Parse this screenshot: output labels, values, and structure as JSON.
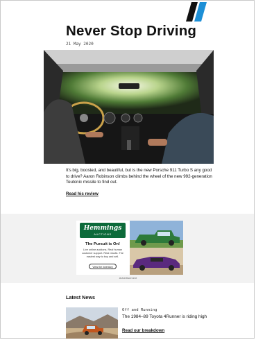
{
  "header": {
    "logo_icon": "double-slash-stripe-logo",
    "title": "Never Stop Driving",
    "date": "21 May 2020"
  },
  "feature": {
    "image_alt_icon": "car-interior-photo",
    "lede": "It's big, boosted, and beautiful, but is the new Porsche 911 Turbo S any good to drive? Aaron Robinson climbs behind the wheel of the new 992-generation Teutonic missile to find out.",
    "link_label": "Read his review"
  },
  "advertisement": {
    "brand": "Hemmings",
    "brand_sub": "AUCTIONS",
    "headline": "The Pursuit is On!",
    "body": "Live online auctions. Real human customer support. Real results. The easiest way to buy and sell.",
    "button_label": "View the inventory",
    "label": "Advertisement"
  },
  "latest_news": {
    "heading": "Latest News",
    "items": [
      {
        "kicker": "Off and Running",
        "headline": "The 1984–89 Toyota 4Runner is riding high",
        "link_label": "Read our breakdown"
      }
    ]
  },
  "colors": {
    "logo_blue": "#1d8fd6",
    "hemmings_green": "#0c6a3a",
    "ad_band": "#f2f2f2"
  }
}
